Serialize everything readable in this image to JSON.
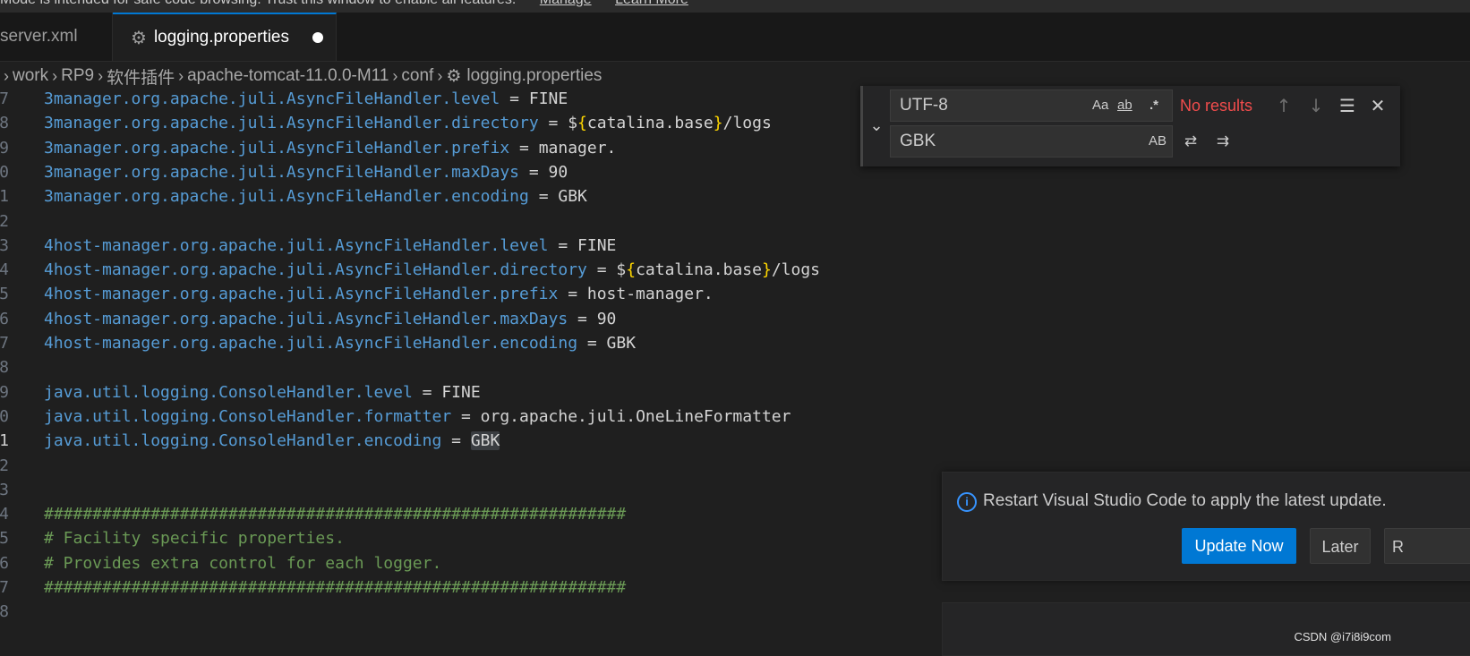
{
  "banner": {
    "text": "Mode is intended for safe code browsing. Trust this window to enable all features.",
    "manage_link": "Manage",
    "learn_more_link": "Learn More"
  },
  "tabs": [
    {
      "label": "server.xml",
      "active": false
    },
    {
      "label": "logging.properties",
      "active": true,
      "dirty": true
    }
  ],
  "breadcrumb": [
    "work",
    "RP9",
    "软件插件",
    "apache-tomcat-11.0.0-M11",
    "conf",
    "logging.properties"
  ],
  "editor": {
    "active_line_number": "1",
    "lines": [
      {
        "ln": "7",
        "key": "3manager.org.apache.juli.AsyncFileHandler.level",
        "eq": " = ",
        "val": "FINE"
      },
      {
        "ln": "8",
        "key": "3manager.org.apache.juli.AsyncFileHandler.directory",
        "eq": " = ",
        "val_pre": "$",
        "brace_open": "{",
        "val_mid": "catalina.base",
        "brace_close": "}",
        "val": "/logs"
      },
      {
        "ln": "9",
        "key": "3manager.org.apache.juli.AsyncFileHandler.prefix",
        "eq": " = ",
        "val": "manager."
      },
      {
        "ln": "0",
        "key": "3manager.org.apache.juli.AsyncFileHandler.maxDays",
        "eq": " = ",
        "val": "90"
      },
      {
        "ln": "1",
        "key": "3manager.org.apache.juli.AsyncFileHandler.encoding",
        "eq": " = ",
        "val": "GBK"
      },
      {
        "ln": "2"
      },
      {
        "ln": "3",
        "key": "4host-manager.org.apache.juli.AsyncFileHandler.level",
        "eq": " = ",
        "val": "FINE"
      },
      {
        "ln": "4",
        "key": "4host-manager.org.apache.juli.AsyncFileHandler.directory",
        "eq": " = ",
        "val_pre": "$",
        "brace_open": "{",
        "val_mid": "catalina.base",
        "brace_close": "}",
        "val": "/logs"
      },
      {
        "ln": "5",
        "key": "4host-manager.org.apache.juli.AsyncFileHandler.prefix",
        "eq": " = ",
        "val": "host-manager."
      },
      {
        "ln": "6",
        "key": "4host-manager.org.apache.juli.AsyncFileHandler.maxDays",
        "eq": " = ",
        "val": "90"
      },
      {
        "ln": "7",
        "key": "4host-manager.org.apache.juli.AsyncFileHandler.encoding",
        "eq": " = ",
        "val": "GBK"
      },
      {
        "ln": "8"
      },
      {
        "ln": "9",
        "key": "java.util.logging.ConsoleHandler.level",
        "eq": " = ",
        "val": "FINE"
      },
      {
        "ln": "0",
        "key": "java.util.logging.ConsoleHandler.formatter",
        "eq": " = ",
        "val": "org.apache.juli.OneLineFormatter"
      },
      {
        "ln": "1",
        "key": "java.util.logging.ConsoleHandler.encoding",
        "eq": " = ",
        "val": "GBK",
        "active": true,
        "highlight": true
      },
      {
        "ln": "2"
      },
      {
        "ln": "3"
      },
      {
        "ln": "4",
        "comment": "############################################################"
      },
      {
        "ln": "5",
        "comment": "# Facility specific properties."
      },
      {
        "ln": "6",
        "comment": "# Provides extra control for each logger."
      },
      {
        "ln": "7",
        "comment": "############################################################"
      },
      {
        "ln": "8"
      }
    ]
  },
  "find_widget": {
    "find_value": "UTF-8",
    "replace_value": "GBK",
    "match_case": "Aa",
    "whole_word": "ab",
    "regex": ".*",
    "preserve_case": "AB",
    "status": "No results"
  },
  "notification": {
    "message": "Restart Visual Studio Code to apply the latest update.",
    "update_now": "Update Now",
    "later": "Later",
    "release_notes": "R"
  },
  "watermark": "CSDN @i7i8i9com",
  "colors": {
    "accent": "#0078d4",
    "error": "#f14c4c",
    "key": "#569cd6",
    "comment": "#6a9955"
  }
}
